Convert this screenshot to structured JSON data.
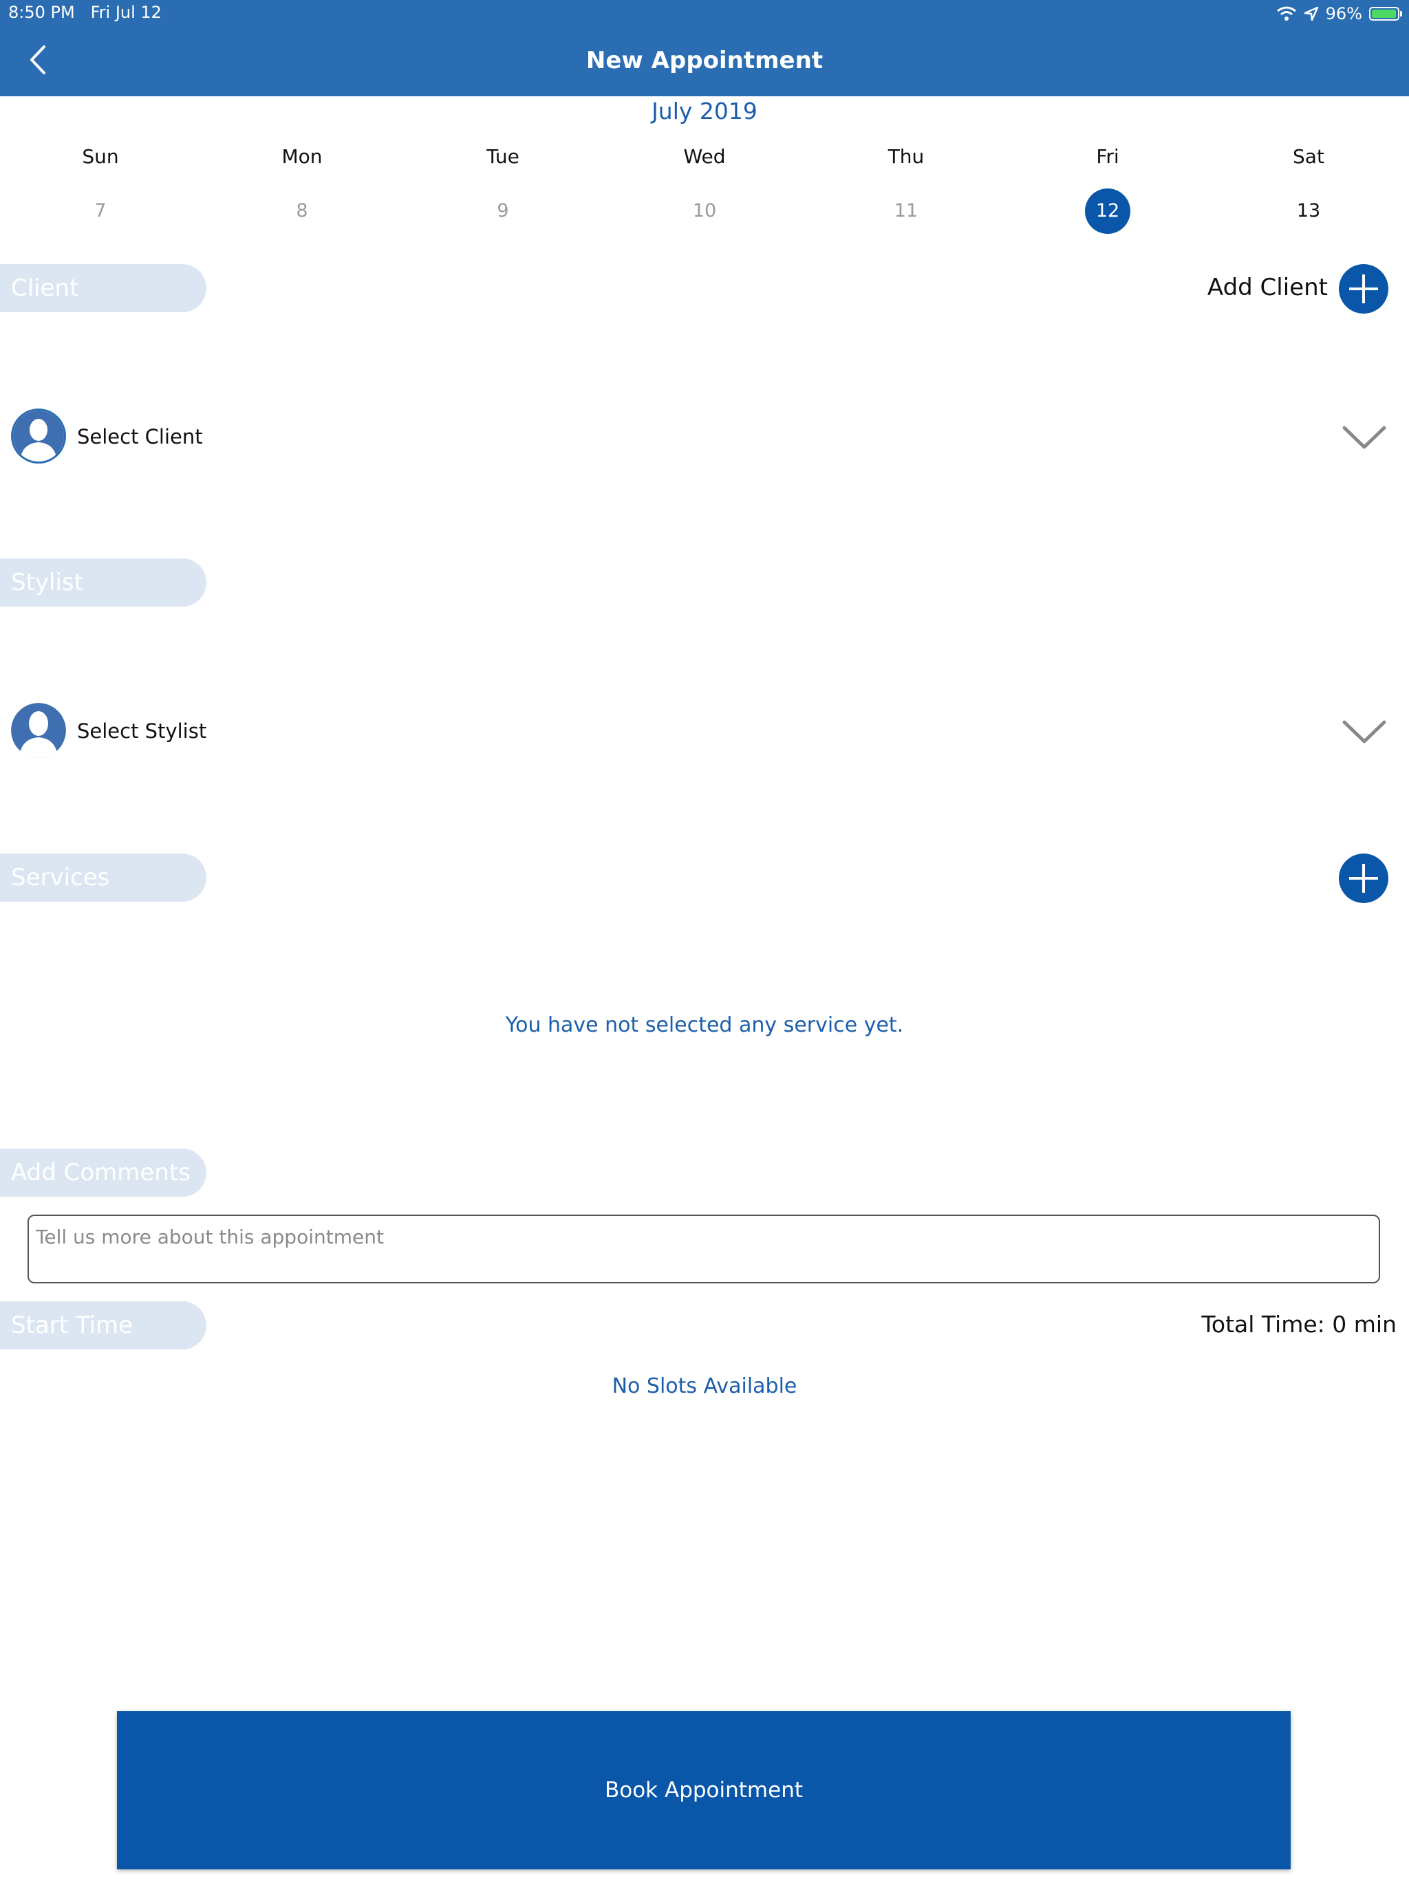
{
  "status_bar": {
    "time": "8:50 PM",
    "date": "Fri Jul 12",
    "battery": "96%",
    "icons": [
      "wifi-icon",
      "location-icon",
      "battery-charging-icon"
    ]
  },
  "nav": {
    "title": "New Appointment",
    "back_icon": "chevron-left-icon"
  },
  "calendar": {
    "month_label": "July 2019",
    "days": [
      {
        "name": "Sun",
        "number": "7"
      },
      {
        "name": "Mon",
        "number": "8"
      },
      {
        "name": "Tue",
        "number": "9"
      },
      {
        "name": "Wed",
        "number": "10"
      },
      {
        "name": "Thu",
        "number": "11"
      },
      {
        "name": "Fri",
        "number": "12",
        "selected": true
      },
      {
        "name": "Sat",
        "number": "13"
      }
    ]
  },
  "client": {
    "section_label": "Client",
    "add_label": "Add Client",
    "select_label": "Select Client"
  },
  "stylist": {
    "section_label": "Stylist",
    "select_label": "Select Stylist"
  },
  "services": {
    "section_label": "Services",
    "empty_message": "You have not selected any service yet."
  },
  "comments": {
    "section_label": "Add Comments",
    "placeholder": "Tell us more about this appointment",
    "value": ""
  },
  "start_time": {
    "section_label": "Start Time",
    "total_time": "Total Time: 0 min",
    "slots_message": "No Slots Available"
  },
  "book_button": {
    "label": "Book Appointment"
  },
  "colors": {
    "nav_bar": "#2a6db2",
    "primary": "#0a56a8",
    "accent_text": "#1b5eac",
    "pill_bg": "#dce6f2"
  }
}
